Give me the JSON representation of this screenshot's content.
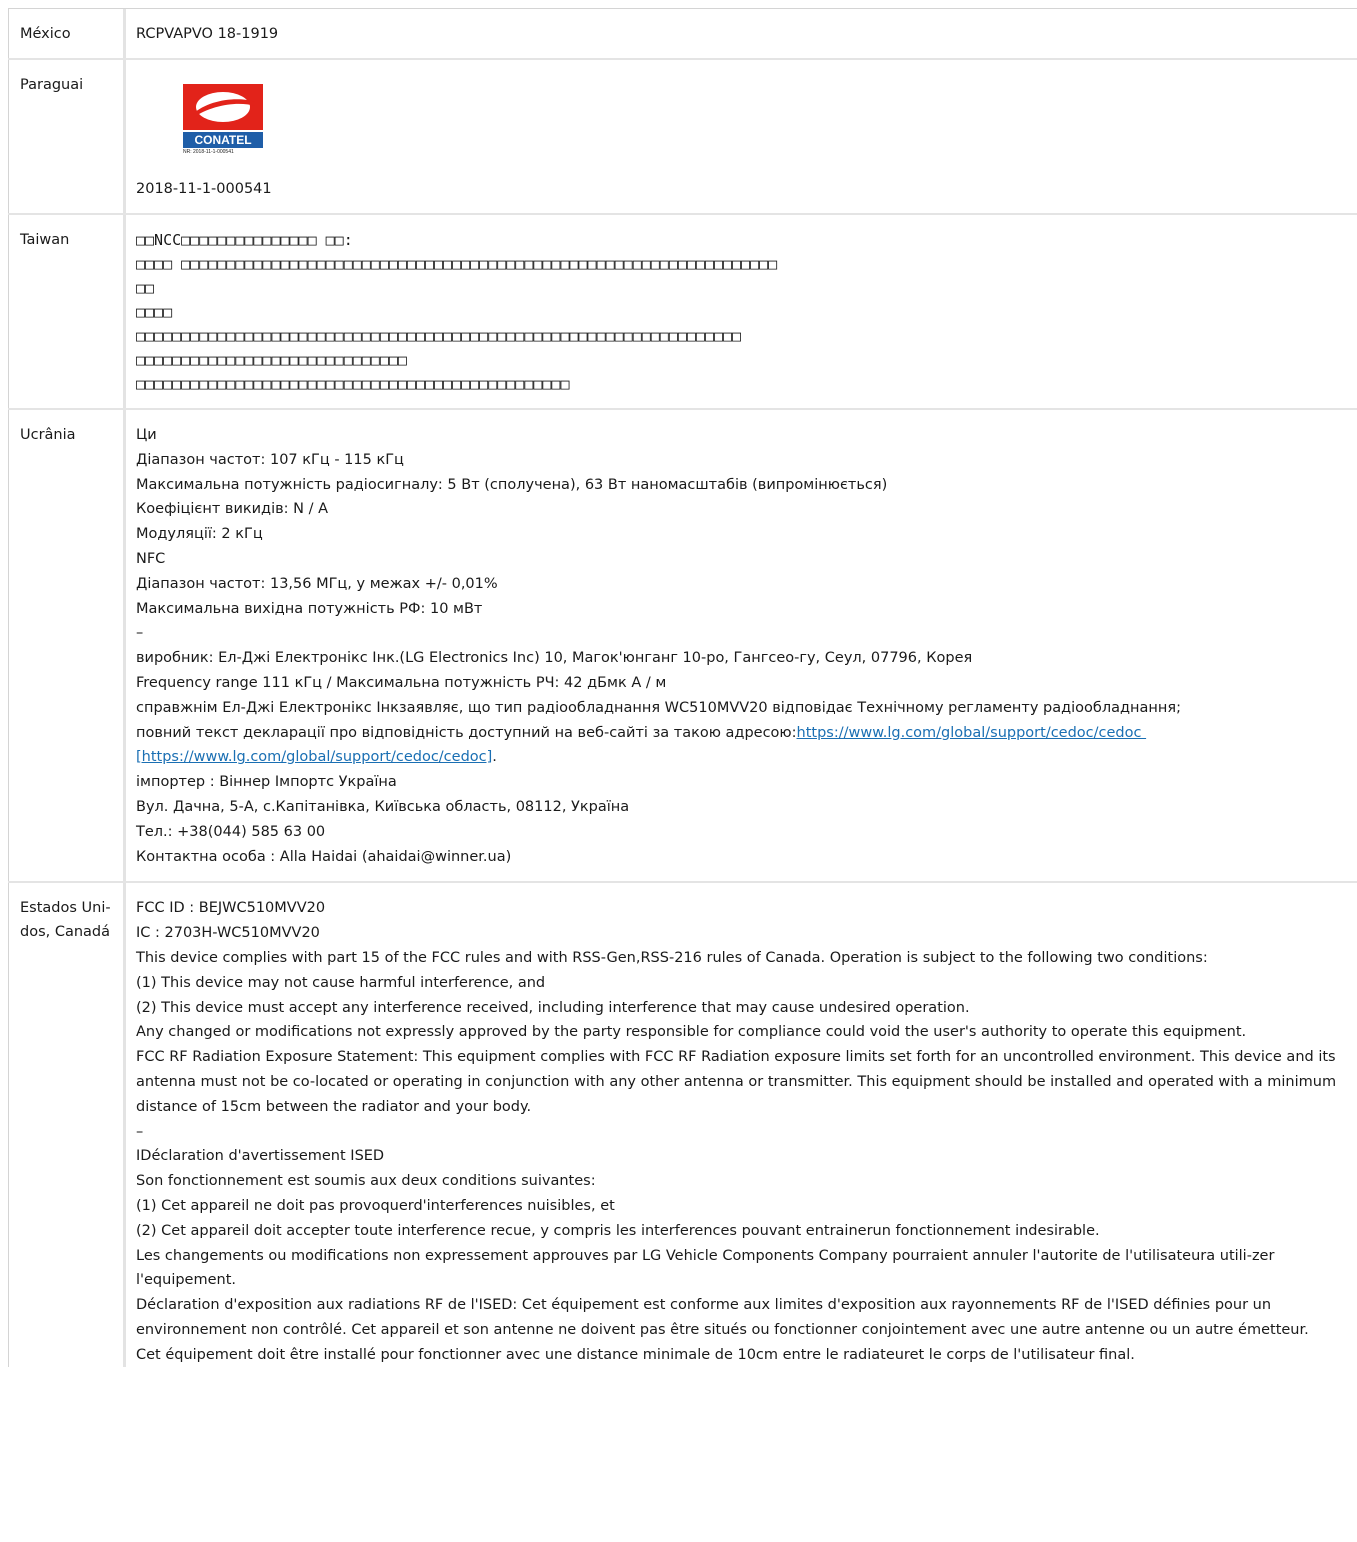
{
  "rows": [
    {
      "country": "México",
      "lines": [
        "RCPVAPVO 18-1919"
      ]
    },
    {
      "country": "Paraguai",
      "logo": {
        "name": "CONATEL",
        "nr": "NR: 2018-11-1-000541",
        "colors": {
          "red": "#e2231a",
          "blue": "#1f5ea8"
        }
      },
      "lines": [
        "2018-11-1-000541"
      ]
    },
    {
      "country": "Taiwan",
      "lines": [
        "□□NCC□□□□□□□□□□□□□□□ □□:",
        "□□□□ □□□□□□□□□□□□□□□□□□□□□□□□□□□□□□□□□□□□□□□□□□□□□□□□□□□□□□□□□□□□□□□□□□",
        "□□",
        "□□□□",
        "□□□□□□□□□□□□□□□□□□□□□□□□□□□□□□□□□□□□□□□□□□□□□□□□□□□□□□□□□□□□□□□□□□□",
        "□□□□□□□□□□□□□□□□□□□□□□□□□□□□□□",
        "□□□□□□□□□□□□□□□□□□□□□□□□□□□□□□□□□□□□□□□□□□□□□□□□"
      ]
    },
    {
      "country": "Ucrânia",
      "lines": [
        "Ци",
        "Діапазон частот: 107 кГц - 115 кГц",
        "Максимальна потужність радіосигналу: 5 Вт (сполучена), 63 Вт наномасштабів (випромінюється)",
        "Коефіцієнт викидів: N / A",
        "Модуляції: 2 кГц",
        "NFC",
        "Діапазон частот: 13,56 МГц, у межах +/- 0,01%",
        "Максимальна вихідна потужність РФ: 10 мВт",
        "–",
        "виробник: Ел-Джі Електронікс Інк.(LG Electronics Inc) 10, Магок'юнганг 10-ро, Гангсео-гу, Сеул, 07796, Корея",
        "Frequency range 111 кГц / Максимальна потужність РЧ: 42 дБмк А / м",
        "справжнім Ел-Джі Електронікс Інкзаявляє, що тип радіообладнання WC510MVV20 відповідає Технічному регламенту радіообладнання;"
      ],
      "declaration_prefix": "повний текст декларації про відповідність доступний на веб-сайті за такою адресою:",
      "declaration_link": "https://www.lg.com/global/support/cedoc/cedoc [https://www.lg.com/global/support/cedoc/cedoc]",
      "declaration_suffix": ".",
      "lines_after": [
        "імпортер : Віннер Імпортс Україна",
        "Вул. Дачна, 5-А, с.Капітанівка, Київська область, 08112, Україна",
        "Тел.: +38(044) 585 63 00",
        "Контактна особа : Alla Haidai (ahaidai@winner.ua)"
      ]
    },
    {
      "country": "Estados Uni-dos, Canadá",
      "lines": [
        "FCC ID : BEJWC510MVV20",
        "IC : 2703H-WC510MVV20",
        "This device complies with part 15 of the FCC rules and with RSS-Gen,RSS-216 rules of Canada. Operation is subject to the following two conditions:",
        "(1) This device may not cause harmful interference, and",
        "(2) This device must accept any interference received, including interference that may cause undesired operation.",
        "Any changed or modifications not expressly approved by the party responsible for compliance could void the user's authority to operate this equipment.",
        "FCC RF Radiation Exposure Statement: This equipment complies with FCC RF Radiation exposure limits set forth for an uncontrolled environment. This device and its antenna must not be co-located or operating in conjunction with any other antenna or transmitter. This equipment should be installed and operated with a minimum distance of 15cm between the radiator and your body.",
        "–",
        "IDéclaration d'avertissement ISED",
        "Son fonctionnement est soumis aux deux conditions suivantes:",
        "(1) Cet appareil ne doit pas provoquerd'interferences nuisibles, et",
        "(2) Cet appareil doit accepter toute interference recue, y compris les interferences pouvant entrainerun fonctionnement indesirable.",
        "Les changements ou modifications non expressement approuves par LG Vehicle Components Company pourraient annuler l'autorite de l'utilisateura utili-zer l'equipement.",
        "Déclaration d'exposition aux radiations RF de l'ISED: Cet équipement est conforme aux limites d'exposition aux rayonnements RF de l'ISED définies pour un environnement non contrôlé. Cet appareil et son antenne ne doivent pas être situés ou fonctionner conjointement avec une autre antenne ou un autre émetteur.",
        "Cet équipement doit être installé pour fonctionner avec une distance minimale de 10cm entre le radiateuret le corps de l'utilisateur final."
      ]
    }
  ]
}
